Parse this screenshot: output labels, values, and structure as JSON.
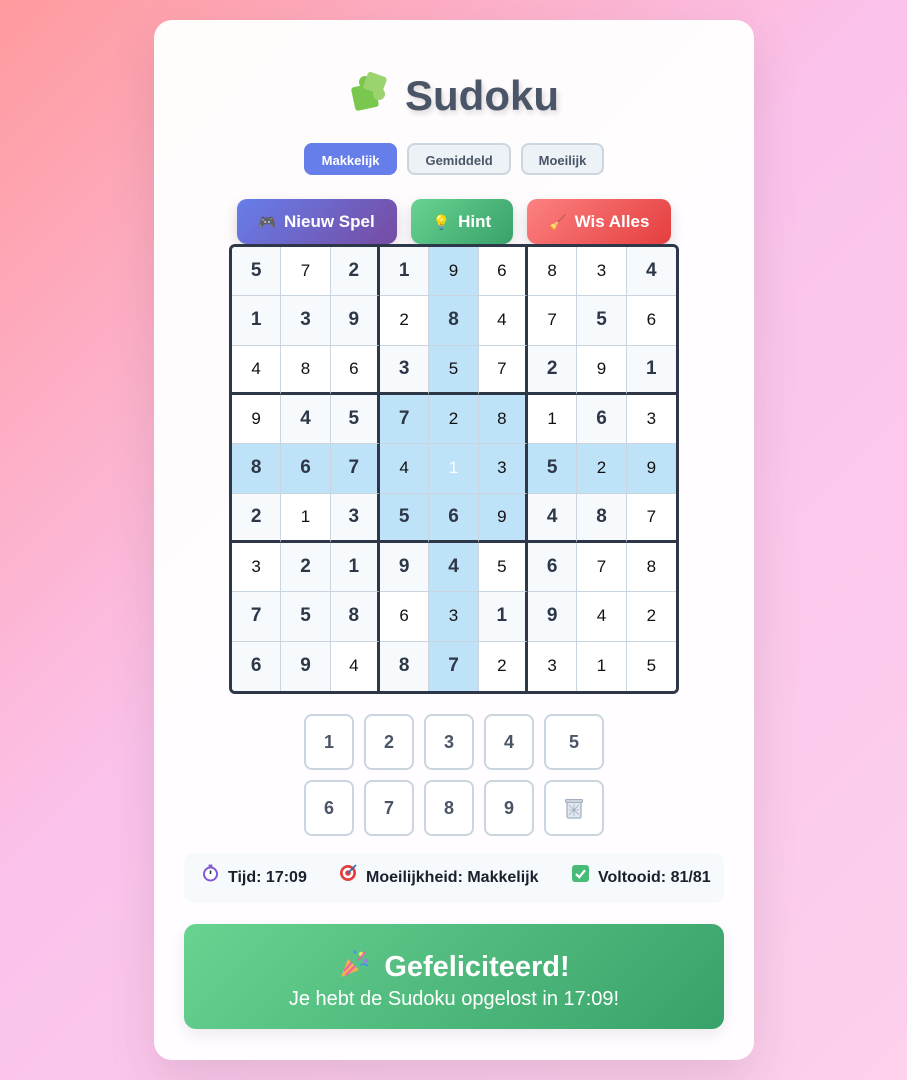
{
  "title": "Sudoku",
  "difficulty_buttons": [
    {
      "label": "Makkelijk",
      "active": true
    },
    {
      "label": "Gemiddeld",
      "active": false
    },
    {
      "label": "Moeilijk",
      "active": false
    }
  ],
  "actions": {
    "new_game": "Nieuw Spel",
    "hint": "Hint",
    "clear_all": "Wis Alles"
  },
  "board": {
    "values": [
      [
        5,
        7,
        2,
        1,
        9,
        6,
        8,
        3,
        4
      ],
      [
        1,
        3,
        9,
        2,
        8,
        4,
        7,
        5,
        6
      ],
      [
        4,
        8,
        6,
        3,
        5,
        7,
        2,
        9,
        1
      ],
      [
        9,
        4,
        5,
        7,
        2,
        8,
        1,
        6,
        3
      ],
      [
        8,
        6,
        7,
        4,
        1,
        3,
        5,
        2,
        9
      ],
      [
        2,
        1,
        3,
        5,
        6,
        9,
        4,
        8,
        7
      ],
      [
        3,
        2,
        1,
        9,
        4,
        5,
        6,
        7,
        8
      ],
      [
        7,
        5,
        8,
        6,
        3,
        1,
        9,
        4,
        2
      ],
      [
        6,
        9,
        4,
        8,
        7,
        2,
        3,
        1,
        5
      ]
    ],
    "given": [
      [
        1,
        0,
        1,
        1,
        0,
        0,
        0,
        0,
        1
      ],
      [
        1,
        1,
        1,
        0,
        1,
        0,
        0,
        1,
        0
      ],
      [
        0,
        0,
        0,
        1,
        0,
        0,
        1,
        0,
        1
      ],
      [
        0,
        1,
        1,
        1,
        0,
        0,
        0,
        1,
        0
      ],
      [
        1,
        1,
        1,
        0,
        0,
        0,
        1,
        0,
        0
      ],
      [
        1,
        0,
        1,
        1,
        1,
        0,
        1,
        1,
        0
      ],
      [
        0,
        1,
        1,
        1,
        1,
        0,
        1,
        0,
        0
      ],
      [
        1,
        1,
        1,
        0,
        0,
        1,
        1,
        0,
        0
      ],
      [
        1,
        1,
        0,
        1,
        1,
        0,
        0,
        0,
        0
      ]
    ],
    "selected": {
      "row": 4,
      "col": 4
    }
  },
  "number_pad": [
    "1",
    "2",
    "3",
    "4",
    "5",
    "6",
    "7",
    "8",
    "9"
  ],
  "stats": {
    "time": "Tijd: 17:09",
    "difficulty": "Moeilijkheid: Makkelijk",
    "completed": "Voltooid: 81/81"
  },
  "banner": {
    "title": "Gefeliciteerd!",
    "subtitle": "Je hebt de Sudoku opgelost in 17:09!"
  },
  "icons": {
    "title": "puzzle-icon",
    "new_game": "gamepad-icon",
    "hint": "lightbulb-icon",
    "clear_all": "broom-icon",
    "erase": "trash-icon",
    "time": "stopwatch-icon",
    "difficulty": "target-icon",
    "completed": "checkmark-icon",
    "banner": "party-popper-icon"
  },
  "colors": {
    "accent": "#667eea",
    "highlight": "#bee3f8",
    "success": "#48bb78",
    "danger": "#f56565"
  }
}
